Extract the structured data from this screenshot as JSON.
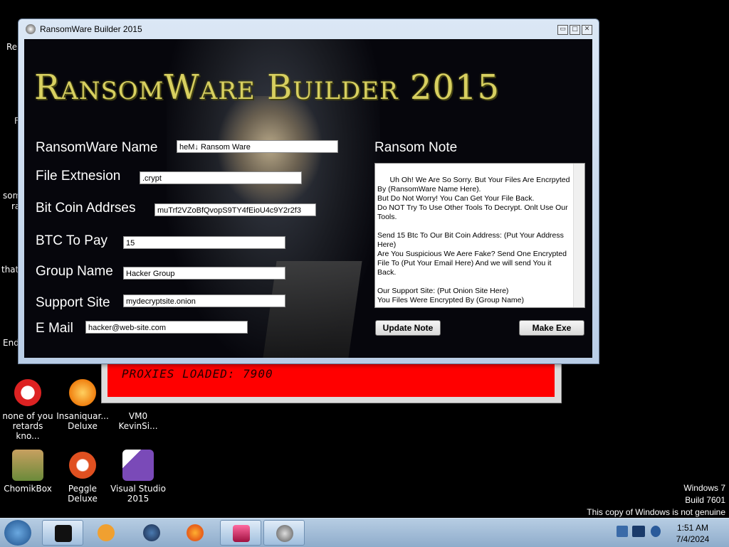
{
  "window": {
    "title": "RansomWare Builder 2015",
    "app_title": "RansomWare Builder 2015",
    "minimize": "▭",
    "maximize": "□",
    "close": "✕"
  },
  "form": {
    "name_label": "RansomWare Name",
    "name_value": "heM↓ Ransom Ware",
    "ext_label": "File Extnesion",
    "ext_value": ".crypt",
    "btc_addr_label": "Bit Coin Addrses",
    "btc_addr_value": "muTrf2VZoBfQvopS9TY4fEioU4c9Y2r2f3",
    "btc_pay_label": "BTC To Pay",
    "btc_pay_value": "15",
    "group_label": "Group Name",
    "group_value": "Hacker Group",
    "site_label": "Support Site",
    "site_value": "mydecryptsite.onion",
    "email_label": "E Mail",
    "email_value": "hacker@web-site.com",
    "note_label": "Ransom Note",
    "note_text": "Uh Oh! We Are So Sorry. But Your Files Are Encrpyted By (RansomWare Name Here).\nBut Do Not Worry! You Can Get Your File Back.\nDo NOT Try To Use Other Tools To Decrypt. Onlt Use Our Tools.\n\nSend 15 Btc To Our Bit Coin Address: (Put Your Address Here)\nAre You Suspicious We Aere Fake? Send One Encrypted File To (Put Your Email Here) And we will send You it Back.\n\nOur Support Site: (Put Onion Site Here)\nYou Files Were Encrypted By (Group Name)",
    "update_button": "Update Note",
    "make_button": "Make Exe"
  },
  "proxy_window": {
    "text": "PROXIES LOADED: 7900"
  },
  "desktop": {
    "partial_labels": [
      "Re",
      "F",
      "som",
      "ra",
      "that",
      "End"
    ],
    "icons": [
      {
        "label": "none of you\nretards kno...",
        "color": "#d22"
      },
      {
        "label": "Insaniquar...\nDeluxe",
        "color": "#f5a020"
      },
      {
        "label": "VM0\nKevinSi...",
        "color": "#000"
      },
      {
        "label": "ChomikBox",
        "color": "#6a8a3a"
      },
      {
        "label": "Peggle Deluxe",
        "color": "#e05020"
      },
      {
        "label": "Visual Studio\n2015",
        "color": "#7a4ab8"
      }
    ]
  },
  "watermark": {
    "line1": "Windows 7",
    "line2": "Build 7601",
    "line3": "This copy of Windows is not genuine"
  },
  "taskbar": {
    "time": "1:51 AM",
    "date": "7/4/2024",
    "start_icon": "windows-orb-icon",
    "items": [
      {
        "name": "terminal-icon",
        "color": "#111"
      },
      {
        "name": "media-player-icon",
        "color": "#f0a030"
      },
      {
        "name": "globe-icon",
        "color": "#2a4a7a"
      },
      {
        "name": "firefox-icon",
        "color": "#e8641c"
      },
      {
        "name": "app-icon",
        "color": "#d0306a"
      },
      {
        "name": "skull-icon",
        "color": "#888"
      }
    ]
  }
}
